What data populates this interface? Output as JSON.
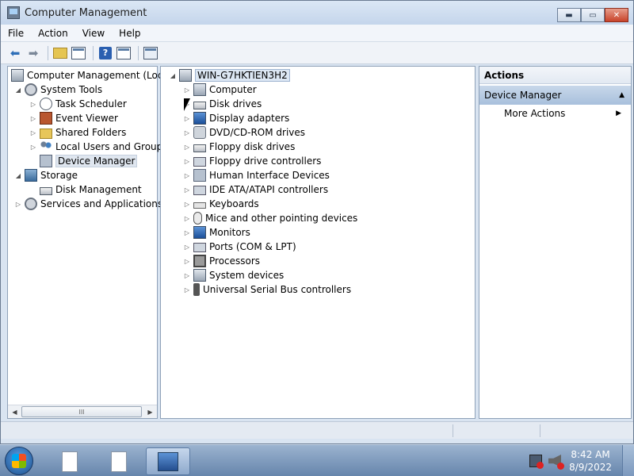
{
  "window": {
    "title": "Computer Management"
  },
  "menubar": {
    "items": [
      "File",
      "Action",
      "View",
      "Help"
    ]
  },
  "left_tree": {
    "root": "Computer Management (Local",
    "system_tools": "System Tools",
    "task_scheduler": "Task Scheduler",
    "event_viewer": "Event Viewer",
    "shared_folders": "Shared Folders",
    "local_users": "Local Users and Groups",
    "device_manager": "Device Manager",
    "storage": "Storage",
    "disk_management": "Disk Management",
    "services": "Services and Applications",
    "scroll_thumb": "III"
  },
  "device_tree": {
    "root": "WIN-G7HKTIEN3H2",
    "items": [
      "Computer",
      "Disk drives",
      "Display adapters",
      "DVD/CD-ROM drives",
      "Floppy disk drives",
      "Floppy drive controllers",
      "Human Interface Devices",
      "IDE ATA/ATAPI controllers",
      "Keyboards",
      "Mice and other pointing devices",
      "Monitors",
      "Ports (COM & LPT)",
      "Processors",
      "System devices",
      "Universal Serial Bus controllers"
    ]
  },
  "actions": {
    "header": "Actions",
    "section": "Device Manager",
    "more": "More Actions"
  },
  "taskbar": {
    "time": "8:42 AM",
    "date": "8/9/2022"
  }
}
